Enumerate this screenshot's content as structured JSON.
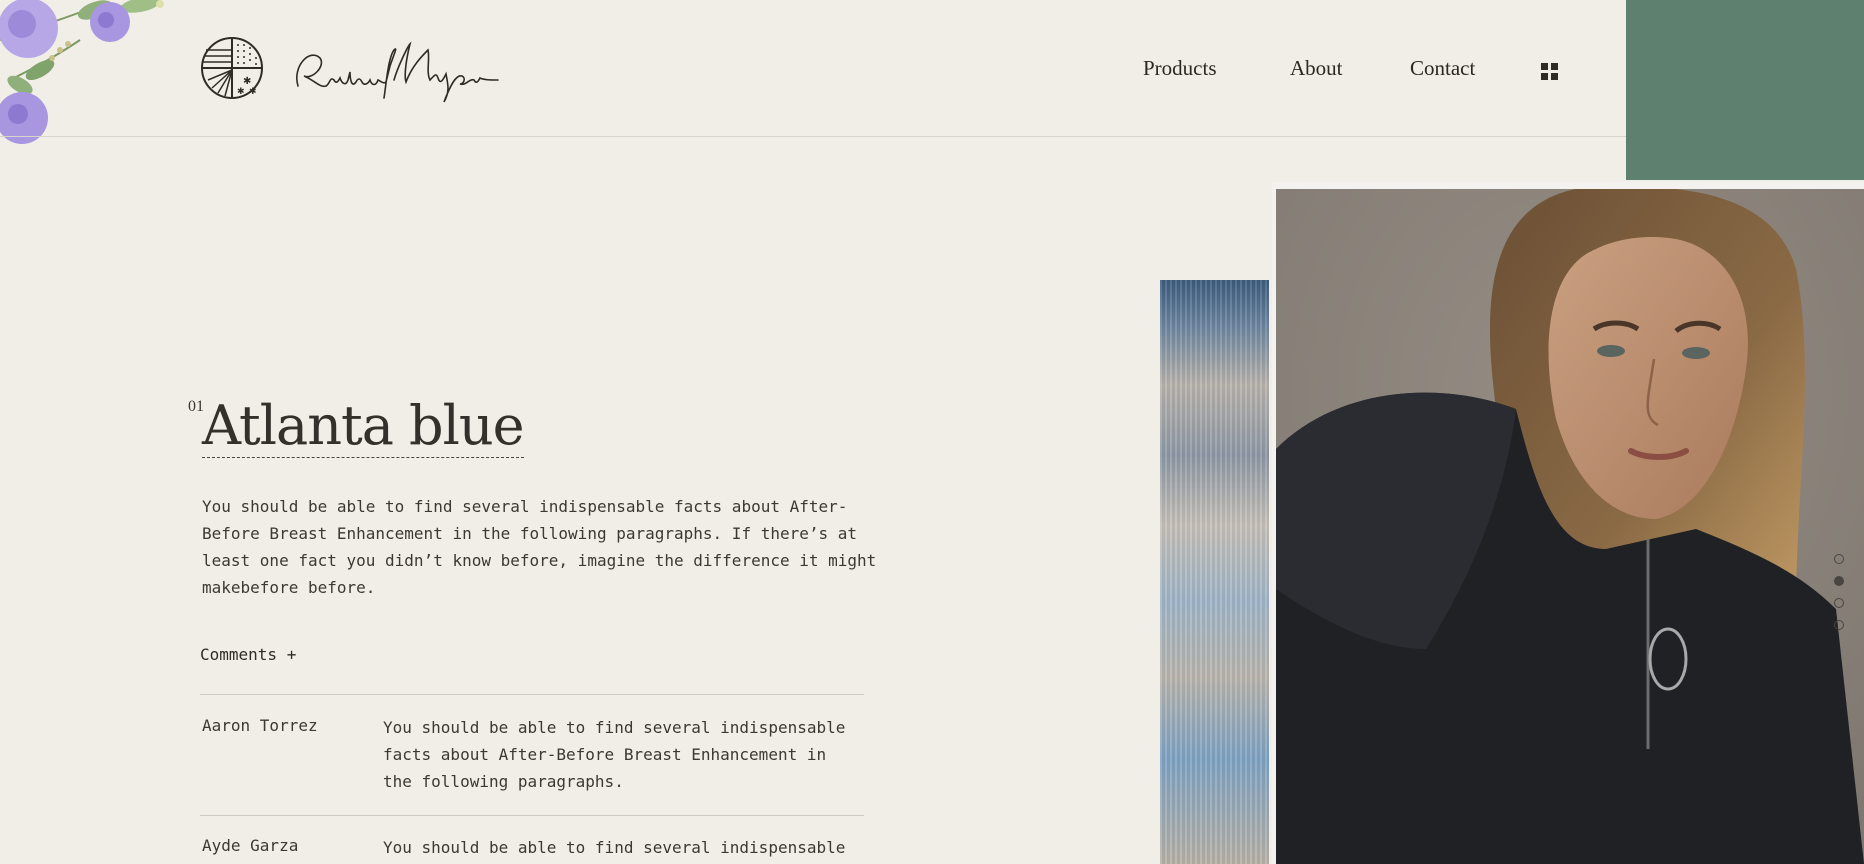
{
  "header": {
    "brand_name": "Richard Nixon",
    "nav": {
      "products": "Products",
      "about": "About",
      "contact": "Contact"
    },
    "menu_icon": "grid-menu-icon"
  },
  "hero": {
    "number": "01",
    "title": "Atlanta blue",
    "description": "You should be able to find several indispensable facts about After-Before Breast Enhancement in the following paragraphs. If there’s at least one fact you didn’t know before, imagine the difference it might makebefore before."
  },
  "comments": {
    "toggle_label": "Comments +",
    "items": [
      {
        "name": "Aaron Torrez",
        "text": "You should be able to find several indispensable facts about After-Before Breast Enhancement in the following paragraphs."
      },
      {
        "name": "Ayde Garza",
        "text": "You should be able to find several indispensable"
      }
    ]
  },
  "slider": {
    "count": 4,
    "active_index": 1
  },
  "colors": {
    "background": "#f1eee8",
    "accent_green": "#5e806e",
    "text": "#2f2b27"
  }
}
